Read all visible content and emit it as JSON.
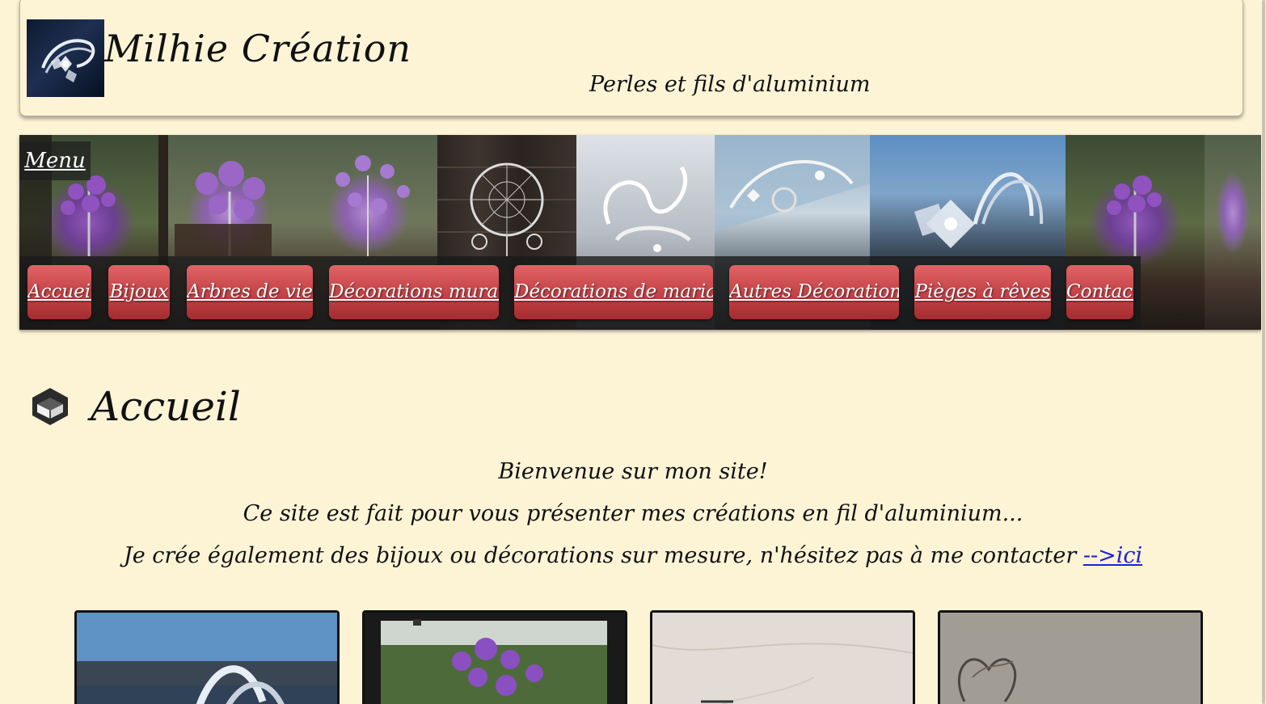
{
  "header": {
    "title": "Milhie Création",
    "subtitle": "Perles et fils d'aluminium",
    "logo_icon": "bracelet-photo-icon"
  },
  "banner": {
    "menu_label": "Menu",
    "nav_items": [
      {
        "label": "Accueil"
      },
      {
        "label": "Bijoux"
      },
      {
        "label": "Arbres de vie"
      },
      {
        "label": "Décorations murales"
      },
      {
        "label": "Décorations de mariage"
      },
      {
        "label": "Autres Décorations"
      },
      {
        "label": "Pièges à rêves"
      },
      {
        "label": "Contact"
      }
    ],
    "accent_color": "#c9474a"
  },
  "main": {
    "section_title": "Accueil",
    "section_icon": "book-icon",
    "intro_lines": [
      "Bienvenue sur mon site!",
      "Ce site est fait pour vous présenter mes créations en fil d'aluminium...",
      "Je crée également des bijoux ou décorations sur mesure, n'hésitez pas à me contacter"
    ],
    "contact_link": "-->ici",
    "link_color": "#1a24d6"
  },
  "gallery": {
    "items": [
      {
        "name": "bracelet-photo"
      },
      {
        "name": "tree-photo"
      },
      {
        "name": "marble-photo"
      },
      {
        "name": "heart-wire-photo"
      }
    ]
  }
}
